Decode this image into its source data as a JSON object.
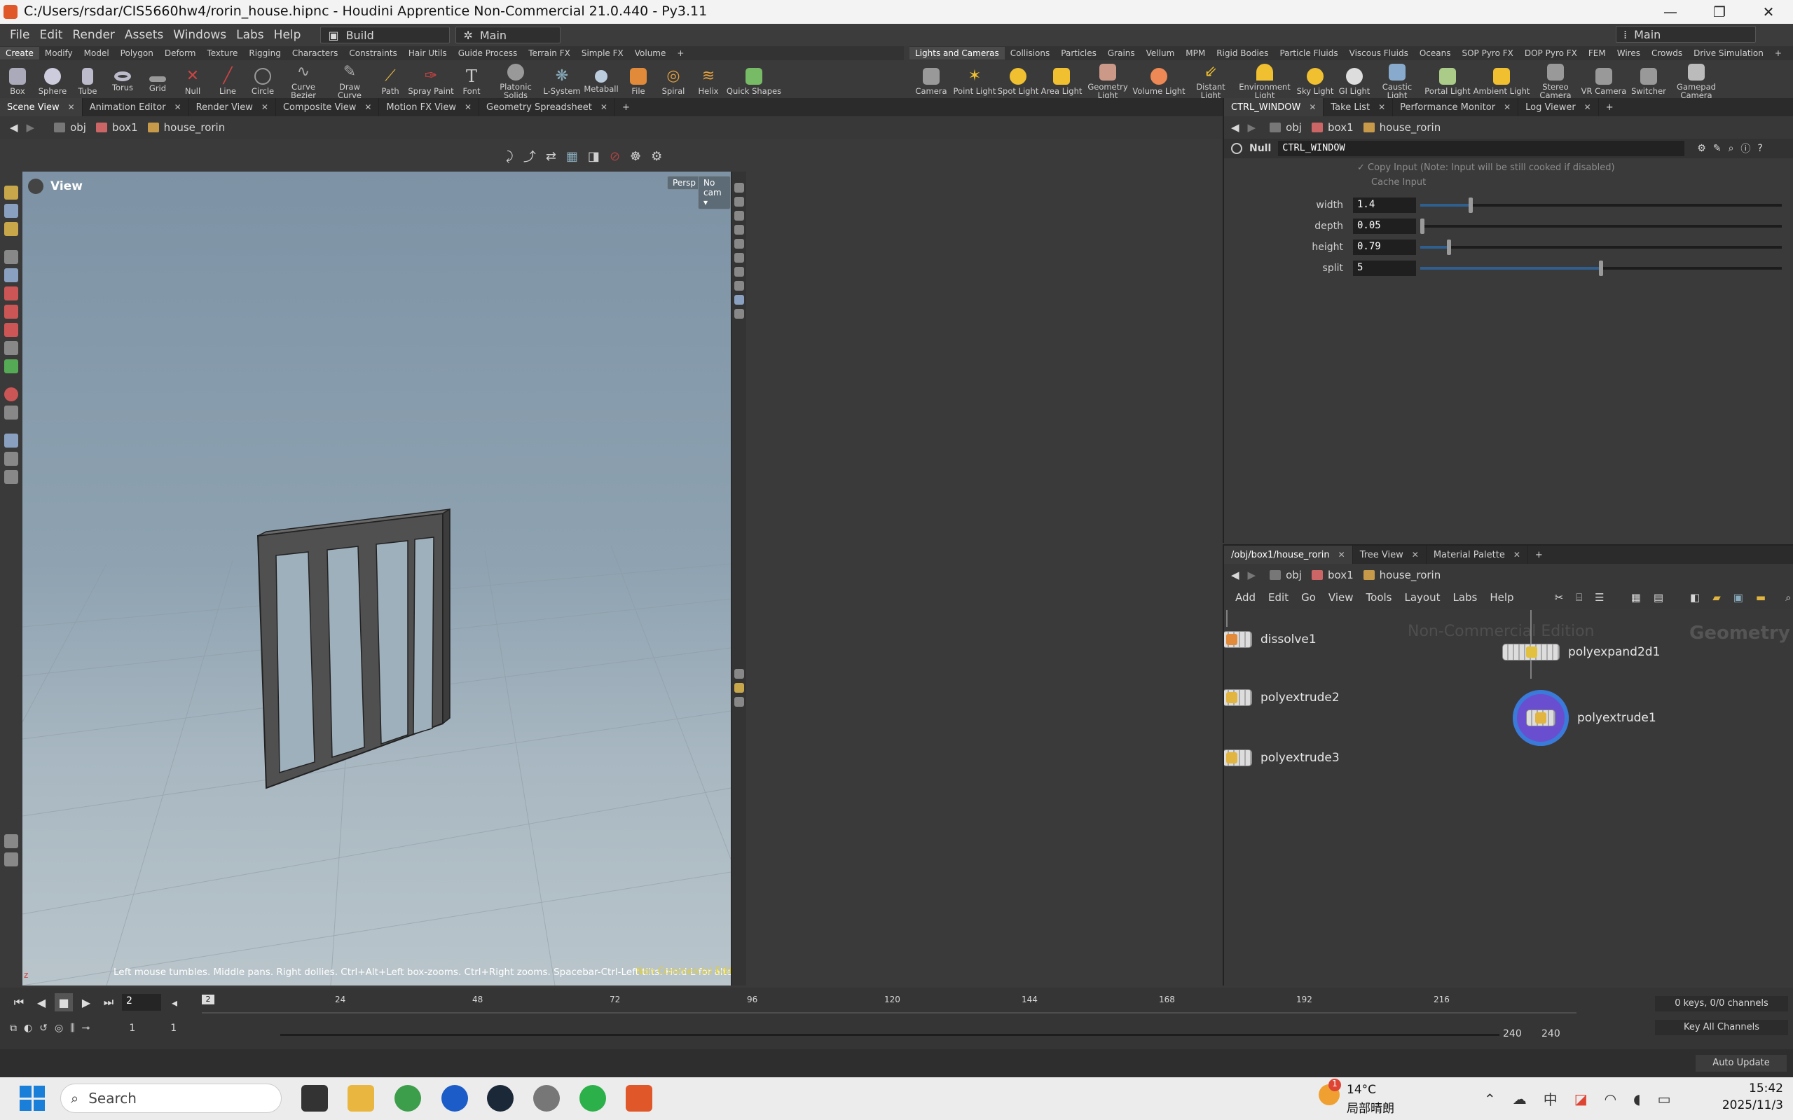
{
  "window": {
    "title": "C:/Users/rsdar/CIS5660hw4/rorin_house.hipnc - Houdini Apprentice Non-Commercial 21.0.440 - Py3.11",
    "min": "—",
    "max": "❐",
    "close": "✕"
  },
  "menu": {
    "items": [
      "File",
      "Edit",
      "Render",
      "Assets",
      "Windows",
      "Labs",
      "Help"
    ],
    "desk_left": "Build",
    "desk_mid": "Main",
    "desk_right": "Main"
  },
  "shelf_left": {
    "tabs": [
      "Create",
      "Modify",
      "Model",
      "Polygon",
      "Deform",
      "Texture",
      "Rigging",
      "Characters",
      "Constraints",
      "Hair Utils",
      "Guide Process",
      "Terrain FX",
      "Simple FX",
      "Volume"
    ],
    "tools": [
      "Box",
      "Sphere",
      "Tube",
      "Torus",
      "Grid",
      "Null",
      "Line",
      "Circle",
      "Curve Bezier",
      "Draw Curve",
      "Path",
      "Spray Paint",
      "Font",
      "Platonic Solids",
      "L-System",
      "Metaball",
      "File",
      "Spiral",
      "Helix",
      "Quick Shapes"
    ]
  },
  "shelf_right": {
    "tabs": [
      "Lights and Cameras",
      "Collisions",
      "Particles",
      "Grains",
      "Vellum",
      "MPM",
      "Rigid Bodies",
      "Particle Fluids",
      "Viscous Fluids",
      "Oceans",
      "SOP Pyro FX",
      "DOP Pyro FX",
      "FEM",
      "Wires",
      "Crowds",
      "Drive Simulation"
    ],
    "tools": [
      "Camera",
      "Point Light",
      "Spot Light",
      "Area Light",
      "Geometry Light",
      "Volume Light",
      "Distant Light",
      "Environment Light",
      "Sky Light",
      "GI Light",
      "Caustic Light",
      "Portal Light",
      "Ambient Light",
      "Stereo Camera",
      "VR Camera",
      "Switcher",
      "Gamepad Camera"
    ]
  },
  "left_pane": {
    "tabs": [
      "Scene View",
      "Animation Editor",
      "Render View",
      "Composite View",
      "Motion FX View",
      "Geometry Spreadsheet"
    ],
    "path": [
      "obj",
      "box1",
      "house_rorin"
    ],
    "view_label": "View",
    "persp": "Persp ▾",
    "cam": "No cam ▾",
    "hint": "Left mouse tumbles. Middle pans. Right dollies. Ctrl+Alt+Left box-zooms. Ctrl+Right zooms. Spacebar-Ctrl-Left tilts. Hold L for alternate tumble, dolly, and zoom. M or Alt+M for First Person Navigation.",
    "watermark": "Non-Commercial Edition"
  },
  "param_pane": {
    "tabs": [
      "CTRL_WINDOW",
      "Take List",
      "Performance Monitor",
      "Log Viewer"
    ],
    "path": [
      "obj",
      "box1",
      "house_rorin"
    ],
    "node_type": "Null",
    "node_name": "CTRL_WINDOW",
    "copy_input": "Copy Input (Note: Input will be still cooked if disabled)",
    "cache_input": "Cache Input",
    "params": [
      {
        "label": "width",
        "value": "1.4",
        "level": 0.14
      },
      {
        "label": "depth",
        "value": "0.05",
        "level": 0.005
      },
      {
        "label": "height",
        "value": "0.79",
        "level": 0.079
      },
      {
        "label": "split",
        "value": "5",
        "level": 0.5
      }
    ]
  },
  "network_pane": {
    "tabs": [
      "/obj/box1/house_rorin",
      "Tree View",
      "Material Palette"
    ],
    "path": [
      "obj",
      "box1",
      "house_rorin"
    ],
    "menu": [
      "Add",
      "Edit",
      "Go",
      "View",
      "Tools",
      "Layout",
      "Labs",
      "Help"
    ],
    "watermark": "Non-Commercial Edition",
    "context": "Geometry",
    "nodes": [
      "dissolve1",
      "polyextrude2",
      "polyextrude3",
      "polyexpand2d1",
      "polyextrude1"
    ]
  },
  "timeline": {
    "current_frame": "2",
    "ticks": [
      "24",
      "48",
      "72",
      "96",
      "120",
      "144",
      "168",
      "192",
      "216"
    ],
    "marker": "2",
    "start": "1",
    "start2": "1",
    "end": "240",
    "end2": "240",
    "keys": "0 keys, 0/0 channels",
    "key_all": "Key All Channels",
    "auto_update": "Auto Update"
  },
  "taskbar": {
    "search": "Search",
    "weather_temp": "14°C",
    "weather_desc": "局部晴朗",
    "badge": "1",
    "time": "15:42",
    "date": "2025/11/3",
    "lang": "中"
  }
}
